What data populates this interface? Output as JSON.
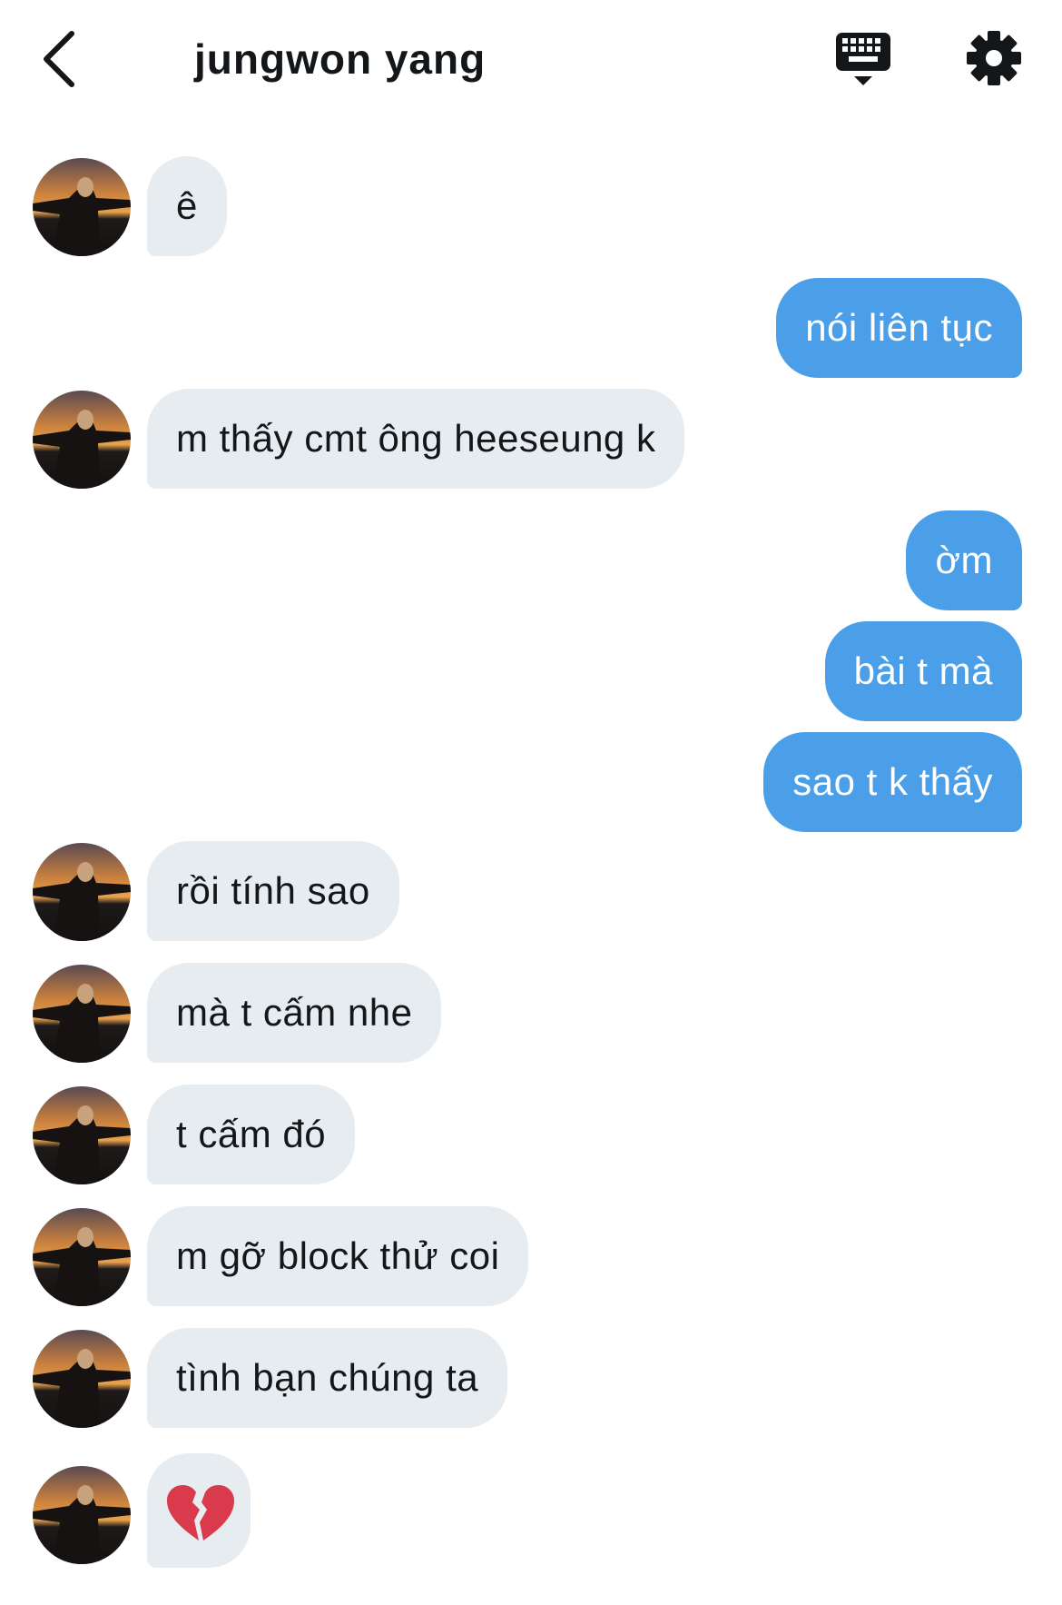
{
  "header": {
    "title": "jungwon yang"
  },
  "icons": {
    "back": "chevron-left-icon",
    "keyboard": "keyboard-icon",
    "settings": "gear-icon",
    "emoji": "broken-heart"
  },
  "colors": {
    "outgoing_bubble": "#4a9fe8",
    "incoming_bubble": "#e6ecf0",
    "text": "#14171a"
  },
  "messages": [
    {
      "from": "them",
      "text": "ê"
    },
    {
      "from": "me",
      "text": "nói liên tục"
    },
    {
      "from": "them",
      "text": "m thấy cmt ông heeseung k"
    },
    {
      "from": "me",
      "text": "ờm"
    },
    {
      "from": "me",
      "text": "bài t mà"
    },
    {
      "from": "me",
      "text": "sao t k thấy"
    },
    {
      "from": "them",
      "text": "rồi tính sao"
    },
    {
      "from": "them",
      "text": "mà t cấm nhe"
    },
    {
      "from": "them",
      "text": "t cấm đó"
    },
    {
      "from": "them",
      "text": "m gỡ block thử coi"
    },
    {
      "from": "them",
      "text": "tình bạn chúng ta"
    },
    {
      "from": "them",
      "text": "💔"
    }
  ]
}
